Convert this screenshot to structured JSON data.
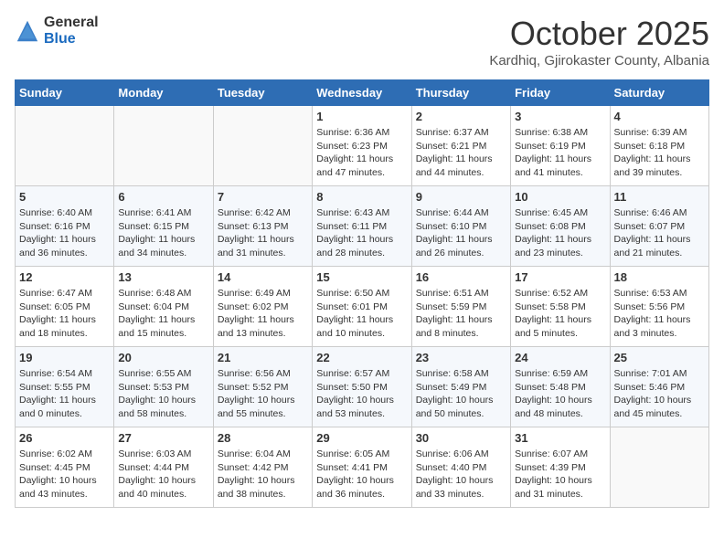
{
  "header": {
    "logo_general": "General",
    "logo_blue": "Blue",
    "month_title": "October 2025",
    "subtitle": "Kardhiq, Gjirokaster County, Albania"
  },
  "weekdays": [
    "Sunday",
    "Monday",
    "Tuesday",
    "Wednesday",
    "Thursday",
    "Friday",
    "Saturday"
  ],
  "weeks": [
    [
      {
        "day": "",
        "info": ""
      },
      {
        "day": "",
        "info": ""
      },
      {
        "day": "",
        "info": ""
      },
      {
        "day": "1",
        "info": "Sunrise: 6:36 AM\nSunset: 6:23 PM\nDaylight: 11 hours\nand 47 minutes."
      },
      {
        "day": "2",
        "info": "Sunrise: 6:37 AM\nSunset: 6:21 PM\nDaylight: 11 hours\nand 44 minutes."
      },
      {
        "day": "3",
        "info": "Sunrise: 6:38 AM\nSunset: 6:19 PM\nDaylight: 11 hours\nand 41 minutes."
      },
      {
        "day": "4",
        "info": "Sunrise: 6:39 AM\nSunset: 6:18 PM\nDaylight: 11 hours\nand 39 minutes."
      }
    ],
    [
      {
        "day": "5",
        "info": "Sunrise: 6:40 AM\nSunset: 6:16 PM\nDaylight: 11 hours\nand 36 minutes."
      },
      {
        "day": "6",
        "info": "Sunrise: 6:41 AM\nSunset: 6:15 PM\nDaylight: 11 hours\nand 34 minutes."
      },
      {
        "day": "7",
        "info": "Sunrise: 6:42 AM\nSunset: 6:13 PM\nDaylight: 11 hours\nand 31 minutes."
      },
      {
        "day": "8",
        "info": "Sunrise: 6:43 AM\nSunset: 6:11 PM\nDaylight: 11 hours\nand 28 minutes."
      },
      {
        "day": "9",
        "info": "Sunrise: 6:44 AM\nSunset: 6:10 PM\nDaylight: 11 hours\nand 26 minutes."
      },
      {
        "day": "10",
        "info": "Sunrise: 6:45 AM\nSunset: 6:08 PM\nDaylight: 11 hours\nand 23 minutes."
      },
      {
        "day": "11",
        "info": "Sunrise: 6:46 AM\nSunset: 6:07 PM\nDaylight: 11 hours\nand 21 minutes."
      }
    ],
    [
      {
        "day": "12",
        "info": "Sunrise: 6:47 AM\nSunset: 6:05 PM\nDaylight: 11 hours\nand 18 minutes."
      },
      {
        "day": "13",
        "info": "Sunrise: 6:48 AM\nSunset: 6:04 PM\nDaylight: 11 hours\nand 15 minutes."
      },
      {
        "day": "14",
        "info": "Sunrise: 6:49 AM\nSunset: 6:02 PM\nDaylight: 11 hours\nand 13 minutes."
      },
      {
        "day": "15",
        "info": "Sunrise: 6:50 AM\nSunset: 6:01 PM\nDaylight: 11 hours\nand 10 minutes."
      },
      {
        "day": "16",
        "info": "Sunrise: 6:51 AM\nSunset: 5:59 PM\nDaylight: 11 hours\nand 8 minutes."
      },
      {
        "day": "17",
        "info": "Sunrise: 6:52 AM\nSunset: 5:58 PM\nDaylight: 11 hours\nand 5 minutes."
      },
      {
        "day": "18",
        "info": "Sunrise: 6:53 AM\nSunset: 5:56 PM\nDaylight: 11 hours\nand 3 minutes."
      }
    ],
    [
      {
        "day": "19",
        "info": "Sunrise: 6:54 AM\nSunset: 5:55 PM\nDaylight: 11 hours\nand 0 minutes."
      },
      {
        "day": "20",
        "info": "Sunrise: 6:55 AM\nSunset: 5:53 PM\nDaylight: 10 hours\nand 58 minutes."
      },
      {
        "day": "21",
        "info": "Sunrise: 6:56 AM\nSunset: 5:52 PM\nDaylight: 10 hours\nand 55 minutes."
      },
      {
        "day": "22",
        "info": "Sunrise: 6:57 AM\nSunset: 5:50 PM\nDaylight: 10 hours\nand 53 minutes."
      },
      {
        "day": "23",
        "info": "Sunrise: 6:58 AM\nSunset: 5:49 PM\nDaylight: 10 hours\nand 50 minutes."
      },
      {
        "day": "24",
        "info": "Sunrise: 6:59 AM\nSunset: 5:48 PM\nDaylight: 10 hours\nand 48 minutes."
      },
      {
        "day": "25",
        "info": "Sunrise: 7:01 AM\nSunset: 5:46 PM\nDaylight: 10 hours\nand 45 minutes."
      }
    ],
    [
      {
        "day": "26",
        "info": "Sunrise: 6:02 AM\nSunset: 4:45 PM\nDaylight: 10 hours\nand 43 minutes."
      },
      {
        "day": "27",
        "info": "Sunrise: 6:03 AM\nSunset: 4:44 PM\nDaylight: 10 hours\nand 40 minutes."
      },
      {
        "day": "28",
        "info": "Sunrise: 6:04 AM\nSunset: 4:42 PM\nDaylight: 10 hours\nand 38 minutes."
      },
      {
        "day": "29",
        "info": "Sunrise: 6:05 AM\nSunset: 4:41 PM\nDaylight: 10 hours\nand 36 minutes."
      },
      {
        "day": "30",
        "info": "Sunrise: 6:06 AM\nSunset: 4:40 PM\nDaylight: 10 hours\nand 33 minutes."
      },
      {
        "day": "31",
        "info": "Sunrise: 6:07 AM\nSunset: 4:39 PM\nDaylight: 10 hours\nand 31 minutes."
      },
      {
        "day": "",
        "info": ""
      }
    ]
  ]
}
